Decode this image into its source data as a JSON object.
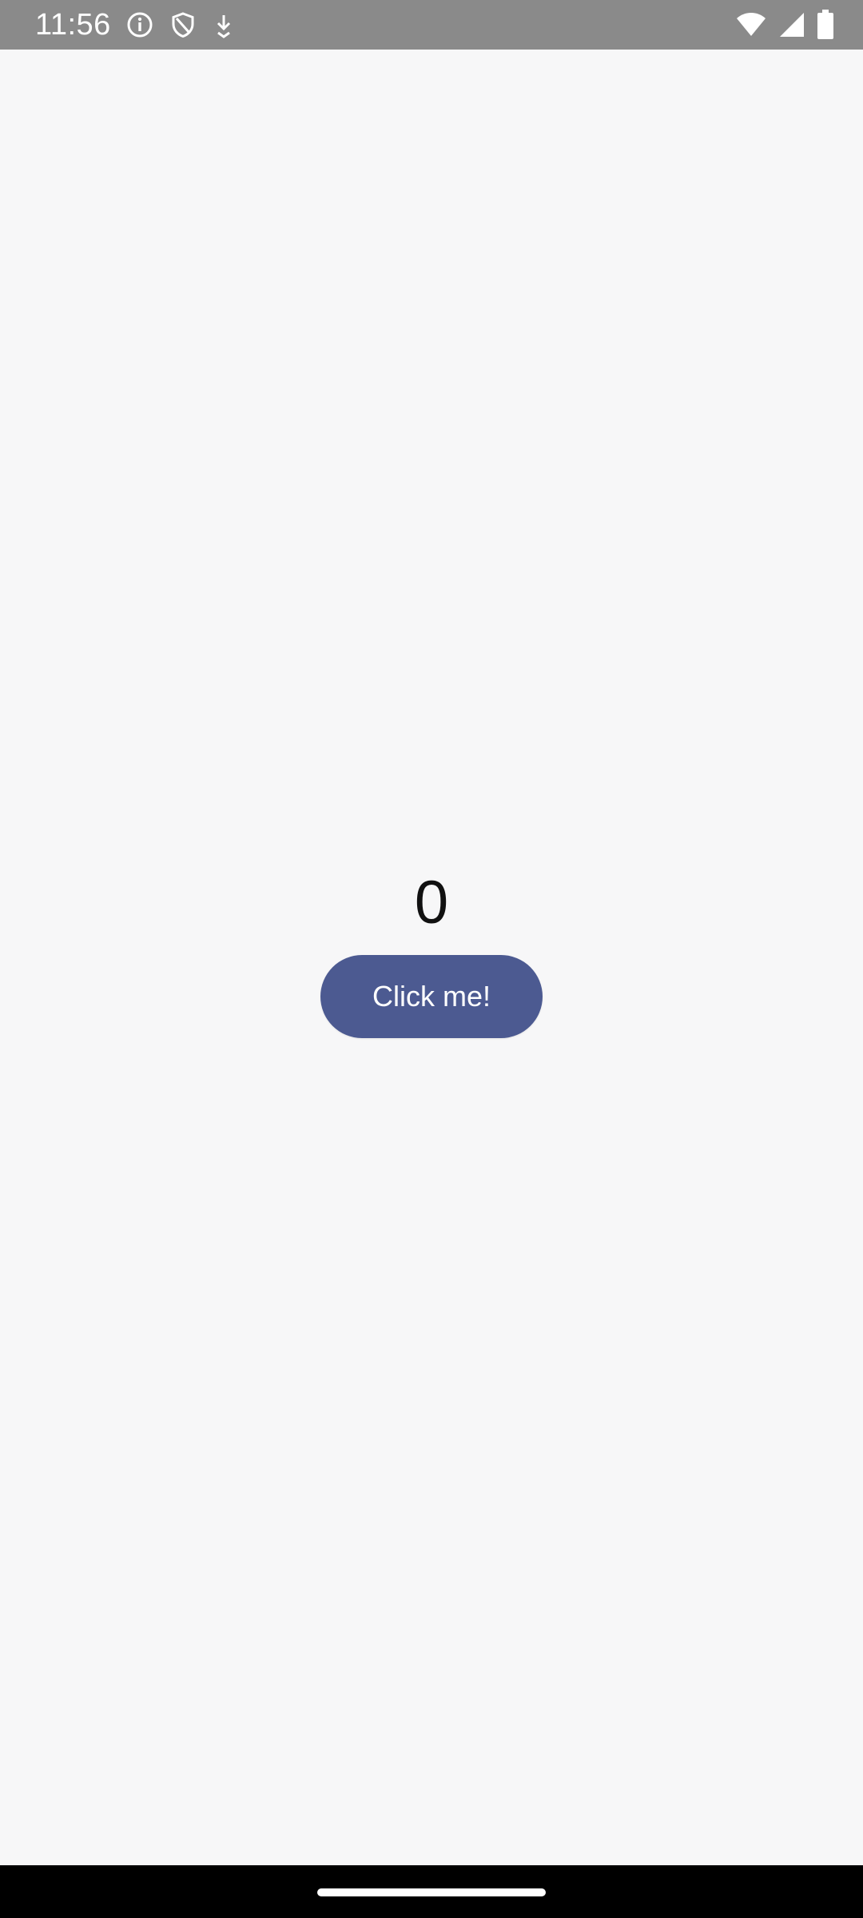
{
  "status_bar": {
    "time": "11:56",
    "icons_left": [
      "info-icon",
      "shield-icon",
      "download-icon"
    ],
    "icons_right": [
      "wifi-icon",
      "signal-icon",
      "battery-icon"
    ]
  },
  "main": {
    "counter_value": "0",
    "button_label": "Click me!"
  },
  "colors": {
    "status_bar_bg": "#8a8a8a",
    "background": "#f7f7f8",
    "button_bg": "#4c5a91",
    "button_text": "#ffffff",
    "nav_bar_bg": "#000000"
  }
}
